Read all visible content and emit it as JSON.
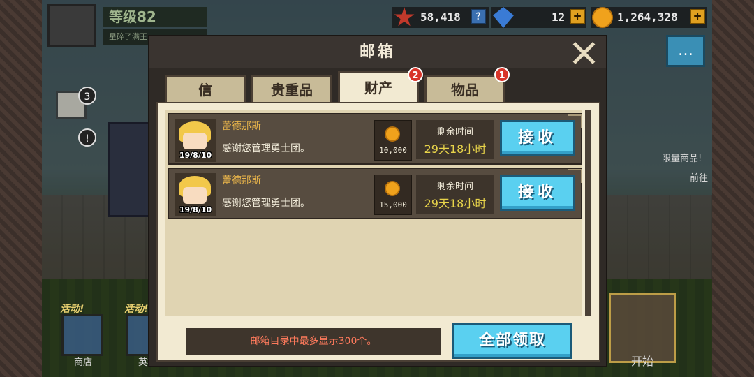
{
  "hud": {
    "level_label": "等级82",
    "subtitle": "星碎了满王",
    "medals": "58,418",
    "gems": "12",
    "coins": "1,264,328",
    "help_label": "?",
    "plus_label": "+"
  },
  "side": {
    "mail_badge": "3",
    "alert_badge": "!",
    "limited_goods": "限量商品!",
    "go_label": "前往",
    "event1": "活动!",
    "event2": "活动!",
    "shop_label": "商店",
    "second_label": "英雄",
    "start_label": "开始",
    "chat_icon": "…"
  },
  "mailbox": {
    "title": "邮箱",
    "tabs": [
      {
        "label": "信",
        "badge": ""
      },
      {
        "label": "贵重品",
        "badge": ""
      },
      {
        "label": "财产",
        "badge": "2"
      },
      {
        "label": "物品",
        "badge": "1"
      }
    ],
    "mails": [
      {
        "sender": "蕾德那斯",
        "message": "感谢您管理勇士团。",
        "date": "19/8/10",
        "reward_amount": "10,000",
        "time_label": "剩余时间",
        "time_value": "29天18小时",
        "button": "接收"
      },
      {
        "sender": "蕾德那斯",
        "message": "感谢您管理勇士团。",
        "date": "19/8/10",
        "reward_amount": "15,000",
        "time_label": "剩余时间",
        "time_value": "29天18小时",
        "button": "接收"
      }
    ],
    "notice": "邮箱目录中最多显示300个。",
    "claim_all": "全部领取"
  },
  "colors": {
    "accent_button": "#5ad0f0",
    "panel_bg": "#f2ead2",
    "badge_red": "#d8352a",
    "time_yellow": "#e8d44a",
    "sender_gold": "#e8b44a",
    "notice_red": "#ff7a5c"
  },
  "icons": [
    "medal-icon",
    "diamond-icon",
    "coin-icon",
    "close-icon",
    "mail-icon",
    "chat-icon"
  ]
}
